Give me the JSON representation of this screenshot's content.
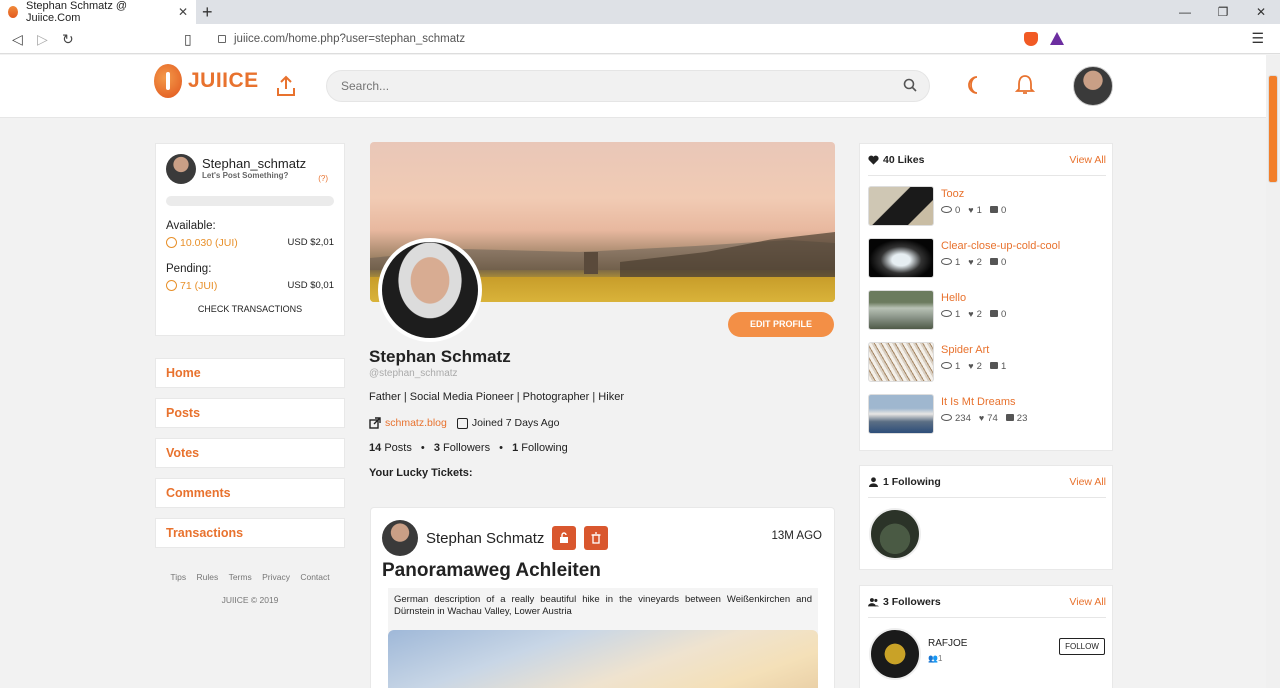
{
  "browser": {
    "tab_title": "Stephan Schmatz @ Juiice.Com",
    "tab_close": "✕",
    "new_tab": "+",
    "url": "juiice.com/home.php?user=stephan_schmatz",
    "window_controls": [
      "—",
      "❐",
      "✕"
    ],
    "nav_icons": [
      "back-icon",
      "forward-icon",
      "reload-icon",
      "bookmark-icon",
      "lock-icon"
    ]
  },
  "header": {
    "logo_text": "JUIICE",
    "search_placeholder": "Search...",
    "icons": [
      "upload-icon",
      "search-icon",
      "moon-icon",
      "bell-icon",
      "avatar"
    ]
  },
  "wallet": {
    "username": "Stephan_schmatz",
    "subtitle": "Let's Post Something?",
    "help": "(?)",
    "available_label": "Available:",
    "available_jui": "10.030 (JUI)",
    "available_usd": "USD $2,01",
    "pending_label": "Pending:",
    "pending_jui": "71 (JUI)",
    "pending_usd": "USD $0,01",
    "check_label": "CHECK TRANSACTIONS"
  },
  "menu": [
    "Home",
    "Posts",
    "Votes",
    "Comments",
    "Transactions"
  ],
  "footer": {
    "links": [
      "Tips",
      "Rules",
      "Terms",
      "Privacy",
      "Contact"
    ],
    "copyright": "JUIICE © 2019"
  },
  "profile": {
    "name": "Stephan Schmatz",
    "handle": "@stephan_schmatz",
    "bio": "Father | Social Media Pioneer | Photographer | Hiker",
    "website": "schmatz.blog",
    "joined": "Joined 7 Days Ago",
    "posts_count": "14",
    "posts_label": "Posts",
    "followers_count": "3",
    "followers_label": "Followers",
    "following_count": "1",
    "following_label": "Following",
    "separator": "•",
    "edit_label": "EDIT PROFILE",
    "lucky_label": "Your Lucky Tickets:"
  },
  "post": {
    "author": "Stephan Schmatz",
    "time": "13M AGO",
    "title": "Panoramaweg Achleiten",
    "description": "German description of a really beautiful hike in the vineyards between Weißenkirchen and Dürnstein in Wachau Valley, Lower Austria"
  },
  "likes": {
    "heading": "40 Likes",
    "view_all": "View All",
    "items": [
      {
        "title": "Tooz",
        "views": "0",
        "likes": "1",
        "comments": "0"
      },
      {
        "title": "Clear-close-up-cold-cool",
        "views": "1",
        "likes": "2",
        "comments": "0"
      },
      {
        "title": "Hello",
        "views": "1",
        "likes": "2",
        "comments": "0"
      },
      {
        "title": "Spider Art",
        "views": "1",
        "likes": "2",
        "comments": "1"
      },
      {
        "title": "It Is Mt Dreams",
        "views": "234",
        "likes": "74",
        "comments": "23"
      }
    ]
  },
  "following": {
    "heading": "1 Following",
    "view_all": "View All"
  },
  "followers": {
    "heading": "3 Followers",
    "view_all": "View All",
    "first": {
      "name": "RAFJOE",
      "count": "1",
      "follow_label": "FOLLOW"
    }
  },
  "colors": {
    "accent": "#e8722e",
    "button": "#f38f46",
    "post_icon": "#d9572e"
  }
}
